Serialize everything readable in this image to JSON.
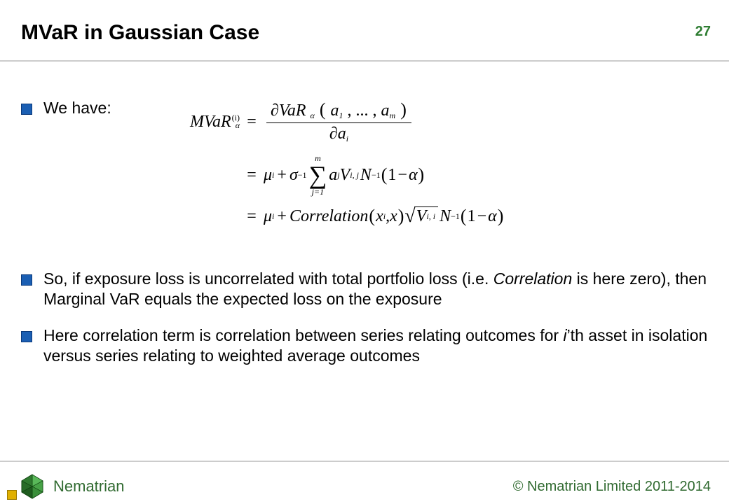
{
  "header": {
    "title": "MVaR in Gaussian Case",
    "slide_number": "27"
  },
  "bullets": [
    {
      "text": "We have:"
    },
    {
      "text_before": "So, if exposure loss is uncorrelated with total portfolio loss (i.e. ",
      "text_ital": "Correlation",
      "text_after": " is here zero), then Marginal VaR equals the expected loss on the exposure"
    },
    {
      "text_before": "Here correlation term is correlation between series relating outcomes for ",
      "text_ital": "i",
      "text_after": "’th asset in isolation versus series relating to weighted average outcomes"
    }
  ],
  "equations": {
    "line1": {
      "lhs_main": "MVaR",
      "lhs_sup": "(i)",
      "lhs_sub": "α",
      "rhs_num_before": "∂VaR",
      "rhs_num_sub": "α",
      "rhs_num_paren": "a",
      "rhs_num_paren_sub1": "1",
      "rhs_num_paren_mid": ", ... , ",
      "rhs_num_paren_sub2": "m",
      "rhs_den_before": "∂a",
      "rhs_den_sub": "i"
    },
    "line2": {
      "mu": "μ",
      "mu_sub": "i",
      "plus": "+",
      "sigma": "σ",
      "sigma_sup": "−1",
      "sum_upper": "m",
      "sum_lower": "j=1",
      "a": "a",
      "a_sub": "j",
      "V": "V",
      "V_sub": "i, j",
      "N": "N",
      "N_sup": "−1",
      "one_minus_alpha_1": "1",
      "one_minus_alpha_minus": "−",
      "one_minus_alpha_a": "α"
    },
    "line3": {
      "mu": "μ",
      "mu_sub": "i",
      "plus": "+",
      "corr": "Correlation",
      "x": "x",
      "x_sub": "i",
      "comma": ", ",
      "x2": "x",
      "V": "V",
      "V_sub": "i, i",
      "N": "N",
      "N_sup": "−1",
      "one_minus_alpha_1": "1",
      "one_minus_alpha_minus": "−",
      "one_minus_alpha_a": "α"
    }
  },
  "footer": {
    "brand": "Nematrian",
    "copyright": "© Nematrian Limited 2011-2014"
  }
}
